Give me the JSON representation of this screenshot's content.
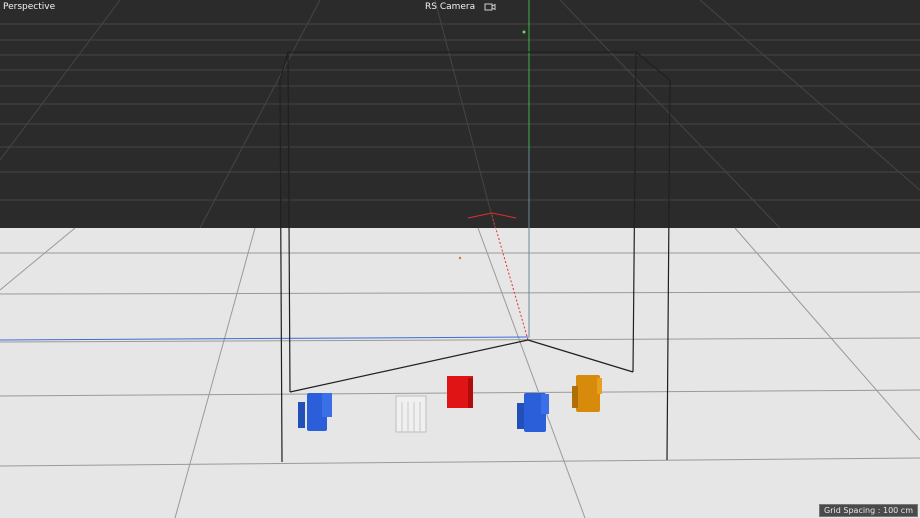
{
  "viewport": {
    "view_name": "Perspective",
    "camera_name": "RS Camera",
    "camera_icon": "camera-icon",
    "grid_spacing": "Grid Spacing : 100 cm"
  },
  "colors": {
    "sky": "#2b2b2b",
    "floor": "#e6e6e6",
    "y_axis": "#3fb24a",
    "x_axis": "#e03030",
    "z_axis": "#3b6fd6",
    "object_blue": "#2a5fd9",
    "object_red": "#e01414",
    "object_white": "#f0f0f0",
    "object_orange": "#d88a0a"
  },
  "scene_objects": [
    {
      "name": "blue-object-left",
      "color": "object_blue"
    },
    {
      "name": "white-object",
      "color": "object_white"
    },
    {
      "name": "red-cube",
      "color": "object_red"
    },
    {
      "name": "blue-object-right",
      "color": "object_blue"
    },
    {
      "name": "orange-object",
      "color": "object_orange"
    }
  ]
}
